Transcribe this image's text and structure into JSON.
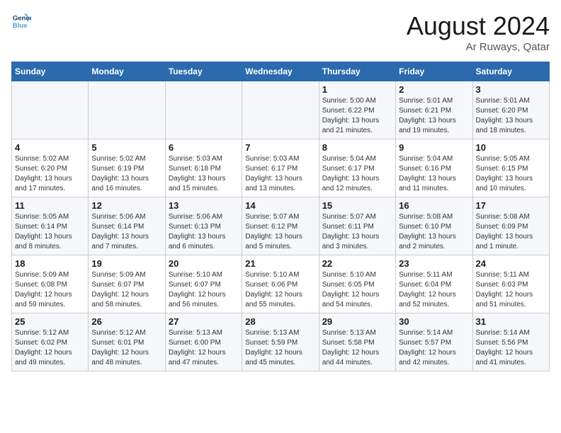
{
  "header": {
    "logo_line1": "General",
    "logo_line2": "Blue",
    "month": "August 2024",
    "location": "Ar Ruways, Qatar"
  },
  "days_of_week": [
    "Sunday",
    "Monday",
    "Tuesday",
    "Wednesday",
    "Thursday",
    "Friday",
    "Saturday"
  ],
  "weeks": [
    [
      {
        "day": "",
        "info": ""
      },
      {
        "day": "",
        "info": ""
      },
      {
        "day": "",
        "info": ""
      },
      {
        "day": "",
        "info": ""
      },
      {
        "day": "1",
        "info": "Sunrise: 5:00 AM\nSunset: 6:22 PM\nDaylight: 13 hours\nand 21 minutes."
      },
      {
        "day": "2",
        "info": "Sunrise: 5:01 AM\nSunset: 6:21 PM\nDaylight: 13 hours\nand 19 minutes."
      },
      {
        "day": "3",
        "info": "Sunrise: 5:01 AM\nSunset: 6:20 PM\nDaylight: 13 hours\nand 18 minutes."
      }
    ],
    [
      {
        "day": "4",
        "info": "Sunrise: 5:02 AM\nSunset: 6:20 PM\nDaylight: 13 hours\nand 17 minutes."
      },
      {
        "day": "5",
        "info": "Sunrise: 5:02 AM\nSunset: 6:19 PM\nDaylight: 13 hours\nand 16 minutes."
      },
      {
        "day": "6",
        "info": "Sunrise: 5:03 AM\nSunset: 6:18 PM\nDaylight: 13 hours\nand 15 minutes."
      },
      {
        "day": "7",
        "info": "Sunrise: 5:03 AM\nSunset: 6:17 PM\nDaylight: 13 hours\nand 13 minutes."
      },
      {
        "day": "8",
        "info": "Sunrise: 5:04 AM\nSunset: 6:17 PM\nDaylight: 13 hours\nand 12 minutes."
      },
      {
        "day": "9",
        "info": "Sunrise: 5:04 AM\nSunset: 6:16 PM\nDaylight: 13 hours\nand 11 minutes."
      },
      {
        "day": "10",
        "info": "Sunrise: 5:05 AM\nSunset: 6:15 PM\nDaylight: 13 hours\nand 10 minutes."
      }
    ],
    [
      {
        "day": "11",
        "info": "Sunrise: 5:05 AM\nSunset: 6:14 PM\nDaylight: 13 hours\nand 8 minutes."
      },
      {
        "day": "12",
        "info": "Sunrise: 5:06 AM\nSunset: 6:14 PM\nDaylight: 13 hours\nand 7 minutes."
      },
      {
        "day": "13",
        "info": "Sunrise: 5:06 AM\nSunset: 6:13 PM\nDaylight: 13 hours\nand 6 minutes."
      },
      {
        "day": "14",
        "info": "Sunrise: 5:07 AM\nSunset: 6:12 PM\nDaylight: 13 hours\nand 5 minutes."
      },
      {
        "day": "15",
        "info": "Sunrise: 5:07 AM\nSunset: 6:11 PM\nDaylight: 13 hours\nand 3 minutes."
      },
      {
        "day": "16",
        "info": "Sunrise: 5:08 AM\nSunset: 6:10 PM\nDaylight: 13 hours\nand 2 minutes."
      },
      {
        "day": "17",
        "info": "Sunrise: 5:08 AM\nSunset: 6:09 PM\nDaylight: 13 hours\nand 1 minute."
      }
    ],
    [
      {
        "day": "18",
        "info": "Sunrise: 5:09 AM\nSunset: 6:08 PM\nDaylight: 12 hours\nand 59 minutes."
      },
      {
        "day": "19",
        "info": "Sunrise: 5:09 AM\nSunset: 6:07 PM\nDaylight: 12 hours\nand 58 minutes."
      },
      {
        "day": "20",
        "info": "Sunrise: 5:10 AM\nSunset: 6:07 PM\nDaylight: 12 hours\nand 56 minutes."
      },
      {
        "day": "21",
        "info": "Sunrise: 5:10 AM\nSunset: 6:06 PM\nDaylight: 12 hours\nand 55 minutes."
      },
      {
        "day": "22",
        "info": "Sunrise: 5:10 AM\nSunset: 6:05 PM\nDaylight: 12 hours\nand 54 minutes."
      },
      {
        "day": "23",
        "info": "Sunrise: 5:11 AM\nSunset: 6:04 PM\nDaylight: 12 hours\nand 52 minutes."
      },
      {
        "day": "24",
        "info": "Sunrise: 5:11 AM\nSunset: 6:03 PM\nDaylight: 12 hours\nand 51 minutes."
      }
    ],
    [
      {
        "day": "25",
        "info": "Sunrise: 5:12 AM\nSunset: 6:02 PM\nDaylight: 12 hours\nand 49 minutes."
      },
      {
        "day": "26",
        "info": "Sunrise: 5:12 AM\nSunset: 6:01 PM\nDaylight: 12 hours\nand 48 minutes."
      },
      {
        "day": "27",
        "info": "Sunrise: 5:13 AM\nSunset: 6:00 PM\nDaylight: 12 hours\nand 47 minutes."
      },
      {
        "day": "28",
        "info": "Sunrise: 5:13 AM\nSunset: 5:59 PM\nDaylight: 12 hours\nand 45 minutes."
      },
      {
        "day": "29",
        "info": "Sunrise: 5:13 AM\nSunset: 5:58 PM\nDaylight: 12 hours\nand 44 minutes."
      },
      {
        "day": "30",
        "info": "Sunrise: 5:14 AM\nSunset: 5:57 PM\nDaylight: 12 hours\nand 42 minutes."
      },
      {
        "day": "31",
        "info": "Sunrise: 5:14 AM\nSunset: 5:56 PM\nDaylight: 12 hours\nand 41 minutes."
      }
    ]
  ]
}
